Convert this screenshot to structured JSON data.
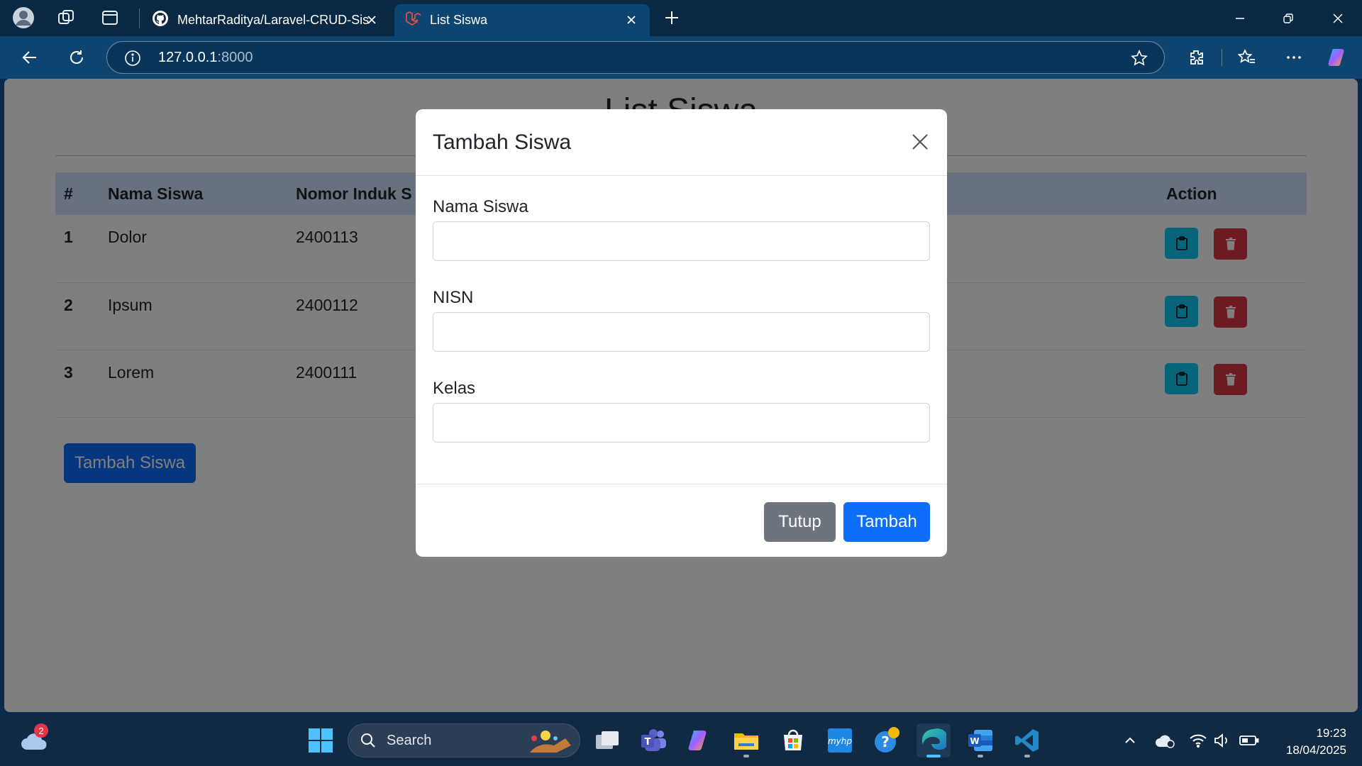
{
  "browser": {
    "tabs": [
      {
        "title": "MehtarRaditya/Laravel-CRUD-Sis",
        "icon": "github-icon",
        "active": false
      },
      {
        "title": "List Siswa",
        "icon": "laravel-icon",
        "active": true
      }
    ],
    "address": {
      "host": "127.0.0.1",
      "port": ":8000"
    }
  },
  "page": {
    "title": "List Siswa",
    "table": {
      "headers": [
        "#",
        "Nama Siswa",
        "Nomor Induk S",
        "Action"
      ],
      "rows": [
        {
          "num": "1",
          "nama": "Dolor",
          "nisn": "2400113"
        },
        {
          "num": "2",
          "nama": "Ipsum",
          "nisn": "2400112"
        },
        {
          "num": "3",
          "nama": "Lorem",
          "nisn": "2400111"
        }
      ]
    },
    "add_button": "Tambah Siswa"
  },
  "modal": {
    "title": "Tambah Siswa",
    "fields": [
      {
        "label": "Nama Siswa",
        "value": ""
      },
      {
        "label": "NISN",
        "value": ""
      },
      {
        "label": "Kelas",
        "value": ""
      }
    ],
    "close_label": "Tutup",
    "submit_label": "Tambah"
  },
  "taskbar": {
    "weather_badge": "2",
    "search_label": "Search",
    "time": "19:23",
    "date": "18/04/2025"
  },
  "colors": {
    "primary": "#0d6efd",
    "secondary": "#6c757d",
    "info": "#0dcaf0",
    "danger": "#dc3545",
    "table_header": "#cfe2ff"
  }
}
